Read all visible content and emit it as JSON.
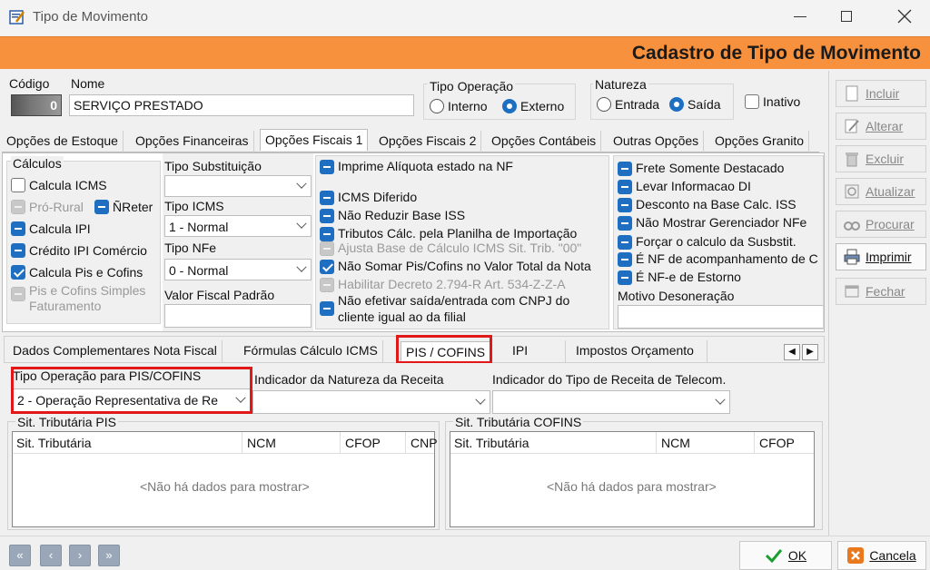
{
  "window": {
    "title": "Tipo de Movimento",
    "banner": "Cadastro de Tipo de Movimento"
  },
  "header": {
    "codigo_label": "Código",
    "codigo_value": "0",
    "nome_label": "Nome",
    "nome_value": "SERVIÇO PRESTADO",
    "tipo_operacao_label": "Tipo Operação",
    "tipo_operacao_options": [
      "Interno",
      "Externo"
    ],
    "tipo_operacao_selected": "Externo",
    "natureza_label": "Natureza",
    "natureza_options": [
      "Entrada",
      "Saída"
    ],
    "natureza_selected": "Saída",
    "inativo_label": "Inativo"
  },
  "tabs": [
    "Opções de Estoque",
    "Opções Financeiras",
    "Opções Fiscais 1",
    "Opções Fiscais 2",
    "Opções Contábeis",
    "Outras Opções",
    "Opções Granito"
  ],
  "active_tab": "Opções Fiscais 1",
  "calculos": {
    "title": "Cálculos",
    "items": [
      {
        "label": "Calcula ICMS",
        "state": "off"
      },
      {
        "label": "Pró-Rural",
        "state": "disabled"
      },
      {
        "label": "ÑReter",
        "state": "indeterminate"
      },
      {
        "label": "Calcula IPI",
        "state": "indeterminate"
      },
      {
        "label": "Crédito IPI Comércio",
        "state": "indeterminate"
      },
      {
        "label": "Calcula Pis e Cofins",
        "state": "on"
      },
      {
        "label": "Pis e Cofins Simples Faturamento",
        "state": "disabled"
      }
    ],
    "line_pis_1": "Pis e Cofins Simples",
    "line_pis_2": "Faturamento"
  },
  "fields_mid": {
    "tipo_substituicao_label": "Tipo Substituição",
    "tipo_substituicao_value": "",
    "tipo_icms_label": "Tipo ICMS",
    "tipo_icms_value": "1 - Normal",
    "tipo_nfe_label": "Tipo NFe",
    "tipo_nfe_value": "0 - Normal",
    "valor_fiscal_label": "Valor Fiscal Padrão"
  },
  "middle_checks": [
    {
      "label": "Imprime Alíquota estado na NF",
      "state": "indeterminate"
    },
    {
      "label": "ICMS Diferido",
      "state": "indeterminate"
    },
    {
      "label": "Não Reduzir Base ISS",
      "state": "indeterminate"
    },
    {
      "label": "Tributos Cálc. pela Planilha de Importação",
      "state": "indeterminate"
    },
    {
      "label": "Ajusta Base de Cálculo ICMS Sit. Trib. \"00\"",
      "state": "disabled"
    },
    {
      "label": "Não Somar Pis/Cofins no Valor Total da Nota",
      "state": "on"
    },
    {
      "label": "Habilitar Decreto 2.794-R Art. 534-Z-Z-A",
      "state": "disabled"
    },
    {
      "label": "Não efetivar saída/entrada com CNPJ do cliente igual ao da filial",
      "state": "indeterminate"
    }
  ],
  "nao_efetivar_line1": "Não efetivar saída/entrada com CNPJ do",
  "nao_efetivar_line2": "cliente igual ao da filial",
  "right_checks": [
    {
      "label": "Frete Somente Destacado",
      "state": "indeterminate"
    },
    {
      "label": "Levar Informacao DI",
      "state": "indeterminate"
    },
    {
      "label": "Desconto na Base Calc. ISS",
      "state": "indeterminate"
    },
    {
      "label": "Não Mostrar Gerenciador NFe",
      "state": "indeterminate"
    },
    {
      "label": "Forçar o calculo da Susbstit.",
      "state": "indeterminate"
    },
    {
      "label": "É NF de acompanhamento de C",
      "state": "indeterminate"
    },
    {
      "label": "É NF-e de Estorno",
      "state": "indeterminate"
    }
  ],
  "motivo_desoneracao_label": "Motivo Desoneração",
  "subtabs": [
    "Dados Complementares Nota Fiscal",
    "Fórmulas Cálculo ICMS",
    "PIS / COFINS",
    "IPI",
    "Impostos Orçamento"
  ],
  "active_subtab": "PIS / COFINS",
  "pis_cofins": {
    "tipo_operacao_label": "Tipo Operação para PIS/COFINS",
    "tipo_operacao_value": "2 - Operação Representativa de Re",
    "indicador_natureza_label": "Indicador da Natureza da Receita",
    "indicador_natureza_value": "",
    "indicador_telecom_label": "Indicador do Tipo de Receita de Telecom.",
    "indicador_telecom_value": "",
    "sit_pis_title": "Sit. Tributária PIS",
    "sit_pis_columns": [
      "Sit. Tributária",
      "NCM",
      "CFOP",
      "CNP"
    ],
    "sit_cofins_title": "Sit. Tributária COFINS",
    "sit_cofins_columns": [
      "Sit. Tributária",
      "NCM",
      "CFOP"
    ],
    "empty_text": "<Não há dados para mostrar>"
  },
  "side_buttons": [
    {
      "label": "Incluir",
      "enabled": false
    },
    {
      "label": "Alterar",
      "enabled": false
    },
    {
      "label": "Excluir",
      "enabled": false
    },
    {
      "label": "Atualizar",
      "enabled": false
    },
    {
      "label": "Procurar",
      "enabled": false
    },
    {
      "label": "Imprimir",
      "enabled": true
    },
    {
      "label": "Fechar",
      "enabled": false
    }
  ],
  "footer": {
    "ok_label": "OK",
    "cancel_label": "Cancela"
  },
  "colors": {
    "banner": "#f7913d",
    "accent": "#1e6fc2",
    "highlight": "#e01818"
  }
}
